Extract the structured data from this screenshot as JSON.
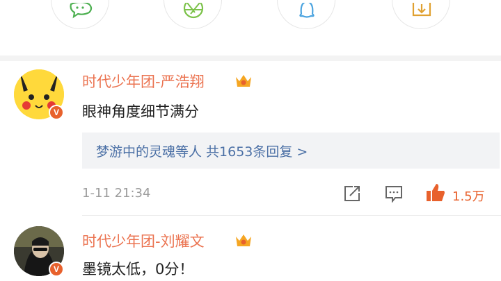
{
  "share_bar": {
    "items": [
      {
        "icon": "wechat-icon"
      },
      {
        "icon": "moments-icon"
      },
      {
        "icon": "qq-icon"
      },
      {
        "icon": "save-icon"
      }
    ]
  },
  "comments": [
    {
      "username": "时代少年团-严浩翔",
      "text": "眼神角度细节满分",
      "replies_label": "梦游中的灵魂等人  共1653条回复 >",
      "timestamp": "1-11 21:34",
      "likes": "1.5万",
      "verified_badge": "V",
      "avatar": "pikachu-avatar"
    },
    {
      "username": "时代少年团-刘耀文",
      "text": "墨镜太低，0分！",
      "verified_badge": "V",
      "avatar": "photo-avatar"
    }
  ],
  "colors": {
    "username": "#eb7350",
    "reply_link": "#4a6fa5",
    "like_active": "#e8612c",
    "badge": "#e8612c",
    "crown": "#f5a623"
  }
}
